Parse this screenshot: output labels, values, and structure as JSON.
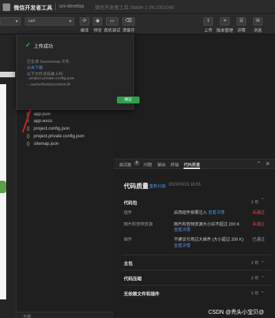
{
  "titlebar": {
    "app_title": "微信开发者工具",
    "project_name": "uni-develop",
    "version": "微信开发者工具 Stable 1.06.2301040"
  },
  "toolbar": {
    "target_value": "cart",
    "buttons": [
      {
        "label": "编译",
        "icon": "compile-icon"
      },
      {
        "label": "预览",
        "icon": "preview-icon"
      },
      {
        "label": "真机调试",
        "icon": "remote-debug-icon"
      },
      {
        "label": "清缓存",
        "icon": "clear-cache-icon"
      },
      {
        "label": "上传",
        "icon": "upload-icon"
      },
      {
        "label": "版本管理",
        "icon": "version-icon"
      },
      {
        "label": "详情",
        "icon": "details-icon"
      },
      {
        "label": "消息",
        "icon": "message-icon"
      }
    ]
  },
  "popup": {
    "title": "上传成功",
    "lines": [
      "已生成 Sourcemap 文件,",
      "点击下载",
      "以下文件没有被上传:",
      "- project.private.config.json",
      "- .cache/fonts/iconfont.ttf"
    ],
    "confirm": "确定"
  },
  "files": [
    {
      "name": "app.json",
      "icon": "json-file-icon"
    },
    {
      "name": "app.wxss",
      "icon": "wxss-file-icon"
    },
    {
      "name": "project.config.json",
      "icon": "json-file-icon"
    },
    {
      "name": "project.private.config.json",
      "icon": "json-file-icon"
    },
    {
      "name": "sitemap.json",
      "icon": "json-file-icon"
    }
  ],
  "explorer_footer": "大纲",
  "quality": {
    "tabs": [
      {
        "label": "调试器",
        "badge": "6"
      },
      {
        "label": "问题"
      },
      {
        "label": "输出"
      },
      {
        "label": "终端"
      },
      {
        "label": "代码质量",
        "active": true
      }
    ],
    "title": "代码质量",
    "rescan": "重新扫描",
    "time": "2023/03/23 16:55",
    "sections": [
      {
        "name": "代码包",
        "count": "3 项"
      },
      {
        "name": "主包",
        "count": "3 项"
      },
      {
        "name": "代码压缩",
        "count": "3 项"
      },
      {
        "name": "无依赖文件和插件",
        "count": "3 项"
      }
    ],
    "items": [
      {
        "name": "组件",
        "desc": "启用组件按需注入",
        "link": "查看详情",
        "status": "未通过",
        "status_type": "fail"
      },
      {
        "name": "图片和音频资源",
        "desc": "图片和音频资源大小应不超过 200 K",
        "link": "查看详情",
        "status": "未通过",
        "status_type": "fail"
      },
      {
        "name": "插件",
        "desc": "不建议引用过大插件 (大小超过 200 K)",
        "link": "查看详情",
        "status": "已通过",
        "status_type": "pass"
      }
    ]
  },
  "watermark": "CSDN @秃头小宝贝@",
  "colors": {
    "accent_green": "#2f9e4f",
    "link_blue": "#4a90e2",
    "fail_red": "#e04a4a",
    "arrow_red": "#e02020"
  }
}
